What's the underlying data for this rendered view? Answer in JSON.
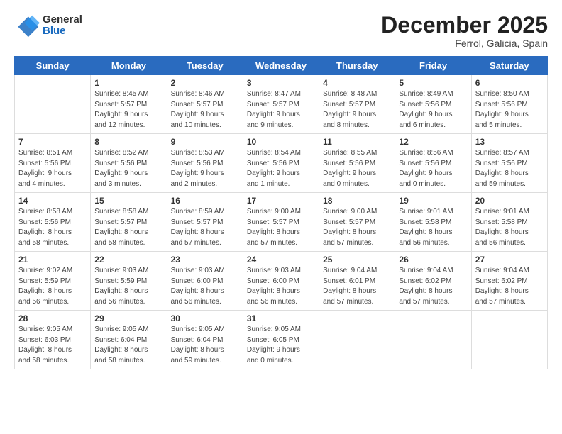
{
  "logo": {
    "line1": "General",
    "line2": "Blue"
  },
  "title": "December 2025",
  "location": "Ferrol, Galicia, Spain",
  "weekdays": [
    "Sunday",
    "Monday",
    "Tuesday",
    "Wednesday",
    "Thursday",
    "Friday",
    "Saturday"
  ],
  "weeks": [
    [
      {
        "day": "",
        "info": ""
      },
      {
        "day": "1",
        "info": "Sunrise: 8:45 AM\nSunset: 5:57 PM\nDaylight: 9 hours\nand 12 minutes."
      },
      {
        "day": "2",
        "info": "Sunrise: 8:46 AM\nSunset: 5:57 PM\nDaylight: 9 hours\nand 10 minutes."
      },
      {
        "day": "3",
        "info": "Sunrise: 8:47 AM\nSunset: 5:57 PM\nDaylight: 9 hours\nand 9 minutes."
      },
      {
        "day": "4",
        "info": "Sunrise: 8:48 AM\nSunset: 5:57 PM\nDaylight: 9 hours\nand 8 minutes."
      },
      {
        "day": "5",
        "info": "Sunrise: 8:49 AM\nSunset: 5:56 PM\nDaylight: 9 hours\nand 6 minutes."
      },
      {
        "day": "6",
        "info": "Sunrise: 8:50 AM\nSunset: 5:56 PM\nDaylight: 9 hours\nand 5 minutes."
      }
    ],
    [
      {
        "day": "7",
        "info": "Sunrise: 8:51 AM\nSunset: 5:56 PM\nDaylight: 9 hours\nand 4 minutes."
      },
      {
        "day": "8",
        "info": "Sunrise: 8:52 AM\nSunset: 5:56 PM\nDaylight: 9 hours\nand 3 minutes."
      },
      {
        "day": "9",
        "info": "Sunrise: 8:53 AM\nSunset: 5:56 PM\nDaylight: 9 hours\nand 2 minutes."
      },
      {
        "day": "10",
        "info": "Sunrise: 8:54 AM\nSunset: 5:56 PM\nDaylight: 9 hours\nand 1 minute."
      },
      {
        "day": "11",
        "info": "Sunrise: 8:55 AM\nSunset: 5:56 PM\nDaylight: 9 hours\nand 0 minutes."
      },
      {
        "day": "12",
        "info": "Sunrise: 8:56 AM\nSunset: 5:56 PM\nDaylight: 9 hours\nand 0 minutes."
      },
      {
        "day": "13",
        "info": "Sunrise: 8:57 AM\nSunset: 5:56 PM\nDaylight: 8 hours\nand 59 minutes."
      }
    ],
    [
      {
        "day": "14",
        "info": "Sunrise: 8:58 AM\nSunset: 5:56 PM\nDaylight: 8 hours\nand 58 minutes."
      },
      {
        "day": "15",
        "info": "Sunrise: 8:58 AM\nSunset: 5:57 PM\nDaylight: 8 hours\nand 58 minutes."
      },
      {
        "day": "16",
        "info": "Sunrise: 8:59 AM\nSunset: 5:57 PM\nDaylight: 8 hours\nand 57 minutes."
      },
      {
        "day": "17",
        "info": "Sunrise: 9:00 AM\nSunset: 5:57 PM\nDaylight: 8 hours\nand 57 minutes."
      },
      {
        "day": "18",
        "info": "Sunrise: 9:00 AM\nSunset: 5:57 PM\nDaylight: 8 hours\nand 57 minutes."
      },
      {
        "day": "19",
        "info": "Sunrise: 9:01 AM\nSunset: 5:58 PM\nDaylight: 8 hours\nand 56 minutes."
      },
      {
        "day": "20",
        "info": "Sunrise: 9:01 AM\nSunset: 5:58 PM\nDaylight: 8 hours\nand 56 minutes."
      }
    ],
    [
      {
        "day": "21",
        "info": "Sunrise: 9:02 AM\nSunset: 5:59 PM\nDaylight: 8 hours\nand 56 minutes."
      },
      {
        "day": "22",
        "info": "Sunrise: 9:03 AM\nSunset: 5:59 PM\nDaylight: 8 hours\nand 56 minutes."
      },
      {
        "day": "23",
        "info": "Sunrise: 9:03 AM\nSunset: 6:00 PM\nDaylight: 8 hours\nand 56 minutes."
      },
      {
        "day": "24",
        "info": "Sunrise: 9:03 AM\nSunset: 6:00 PM\nDaylight: 8 hours\nand 56 minutes."
      },
      {
        "day": "25",
        "info": "Sunrise: 9:04 AM\nSunset: 6:01 PM\nDaylight: 8 hours\nand 57 minutes."
      },
      {
        "day": "26",
        "info": "Sunrise: 9:04 AM\nSunset: 6:02 PM\nDaylight: 8 hours\nand 57 minutes."
      },
      {
        "day": "27",
        "info": "Sunrise: 9:04 AM\nSunset: 6:02 PM\nDaylight: 8 hours\nand 57 minutes."
      }
    ],
    [
      {
        "day": "28",
        "info": "Sunrise: 9:05 AM\nSunset: 6:03 PM\nDaylight: 8 hours\nand 58 minutes."
      },
      {
        "day": "29",
        "info": "Sunrise: 9:05 AM\nSunset: 6:04 PM\nDaylight: 8 hours\nand 58 minutes."
      },
      {
        "day": "30",
        "info": "Sunrise: 9:05 AM\nSunset: 6:04 PM\nDaylight: 8 hours\nand 59 minutes."
      },
      {
        "day": "31",
        "info": "Sunrise: 9:05 AM\nSunset: 6:05 PM\nDaylight: 9 hours\nand 0 minutes."
      },
      {
        "day": "",
        "info": ""
      },
      {
        "day": "",
        "info": ""
      },
      {
        "day": "",
        "info": ""
      }
    ]
  ]
}
